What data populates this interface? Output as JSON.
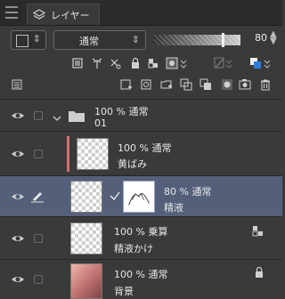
{
  "panel": {
    "tab_label": "レイヤー"
  },
  "toolbar": {
    "blend_mode": "通常",
    "opacity_value": "80",
    "opacity_fraction": 0.8,
    "layer_color": "#f2f2f2"
  },
  "icons": {
    "menu": "menu-icon",
    "layers_tab": "layers-icon",
    "visibility": "eye-icon",
    "pen": "pen-icon",
    "folder": "folder-icon",
    "lock": "lock-icon",
    "trash": "trash-icon"
  },
  "layers": [
    {
      "opacity_mode": "100 % 通常",
      "name": "01",
      "type": "folder"
    },
    {
      "opacity_mode": "100 % 通常",
      "name": "黄ばみ",
      "type": "layer"
    },
    {
      "opacity_mode": "80 % 通常",
      "name": "精液",
      "type": "layer",
      "selected": true
    },
    {
      "opacity_mode": "100 % 乗算",
      "name": "精液かけ",
      "type": "layer"
    },
    {
      "opacity_mode": "100 % 通常",
      "name": "背景",
      "type": "layer",
      "locked": true
    }
  ],
  "colors": {
    "panel_bg": "#3a3a3a",
    "selected_bg": "#54607a",
    "accent_red": "#d66f73",
    "accent_blue": "#2d7fe0"
  }
}
